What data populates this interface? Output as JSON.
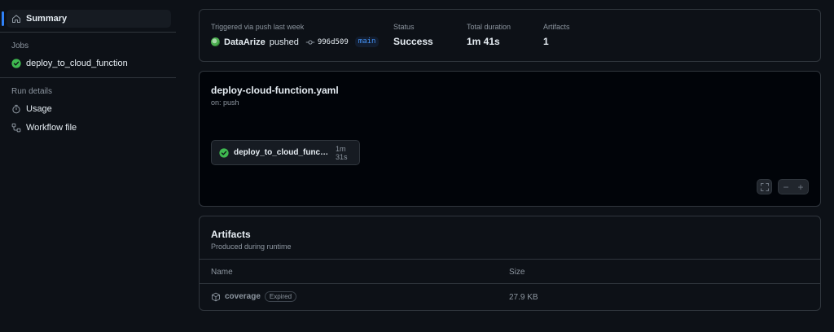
{
  "sidebar": {
    "summary_label": "Summary",
    "jobs_heading": "Jobs",
    "job_label": "deploy_to_cloud_function",
    "run_details_heading": "Run details",
    "usage_label": "Usage",
    "workflow_file_label": "Workflow file"
  },
  "summary": {
    "trigger_label": "Triggered via push last week",
    "actor": "DataArize",
    "action": "pushed",
    "commit_sha": "996d509",
    "branch": "main",
    "status_label": "Status",
    "status_value": "Success",
    "duration_label": "Total duration",
    "duration_value": "1m 41s",
    "artifacts_label": "Artifacts",
    "artifacts_value": "1"
  },
  "workflow": {
    "file_name": "deploy-cloud-function.yaml",
    "trigger": "on: push",
    "job_name": "deploy_to_cloud_functi…",
    "job_duration": "1m 31s"
  },
  "artifacts": {
    "title": "Artifacts",
    "subtitle": "Produced during runtime",
    "col_name": "Name",
    "col_size": "Size",
    "rows": [
      {
        "name": "coverage",
        "badge": "Expired",
        "size": "27.9 KB"
      }
    ]
  },
  "colors": {
    "background": "#0d1117",
    "success": "#3fb950",
    "accent": "#2f81f7",
    "border": "#30363d"
  },
  "icons": [
    "home-icon",
    "check-circle-icon",
    "stopwatch-icon",
    "workflow-icon",
    "commit-icon",
    "fullscreen-icon",
    "zoom-out-icon",
    "zoom-in-icon",
    "package-icon"
  ]
}
